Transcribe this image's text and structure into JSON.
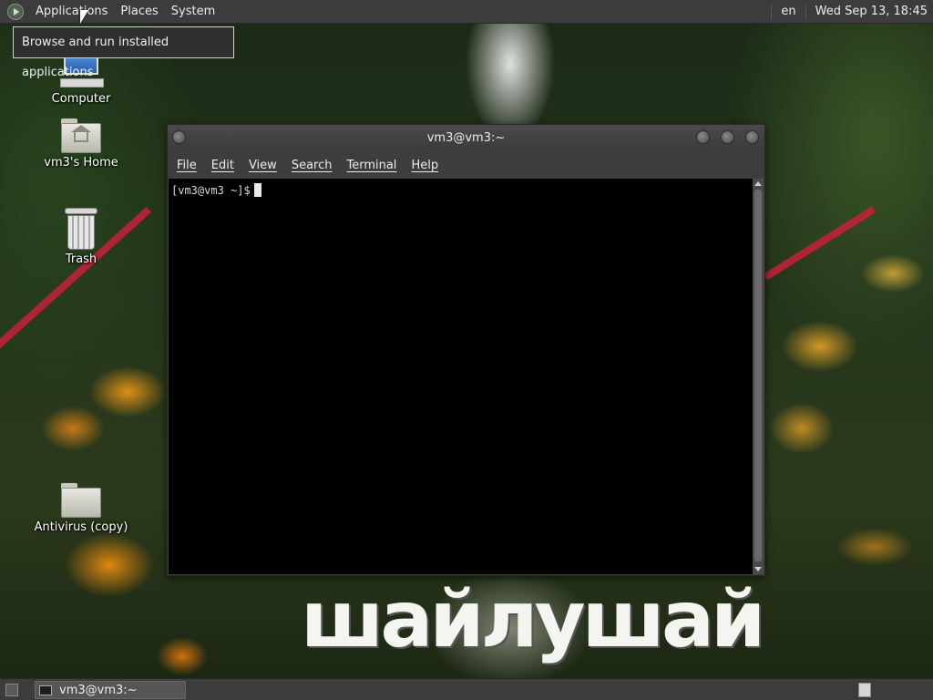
{
  "top_panel": {
    "menus": {
      "applications": "Applications",
      "places": "Places",
      "system": "System"
    },
    "keyboard_layout": "en",
    "clock": "Wed Sep 13, 18:45"
  },
  "tooltip": {
    "text": "Browse and run installed applications"
  },
  "desktop_icons": {
    "computer": "Computer",
    "home": "vm3's Home",
    "trash": "Trash",
    "folder": "Antivirus (copy)"
  },
  "wallpaper_text": "шайлушай",
  "terminal": {
    "title": "vm3@vm3:~",
    "menu": {
      "file": "File",
      "edit": "Edit",
      "view": "View",
      "search": "Search",
      "terminal": "Terminal",
      "help": "Help"
    },
    "prompt": "[vm3@vm3 ~]$"
  },
  "bottom_panel": {
    "task_label": "vm3@vm3:~"
  },
  "colors": {
    "panel_bg": "#3c3c3c",
    "terminal_bg": "#000000",
    "window_chrome": "#3d3d3d"
  }
}
